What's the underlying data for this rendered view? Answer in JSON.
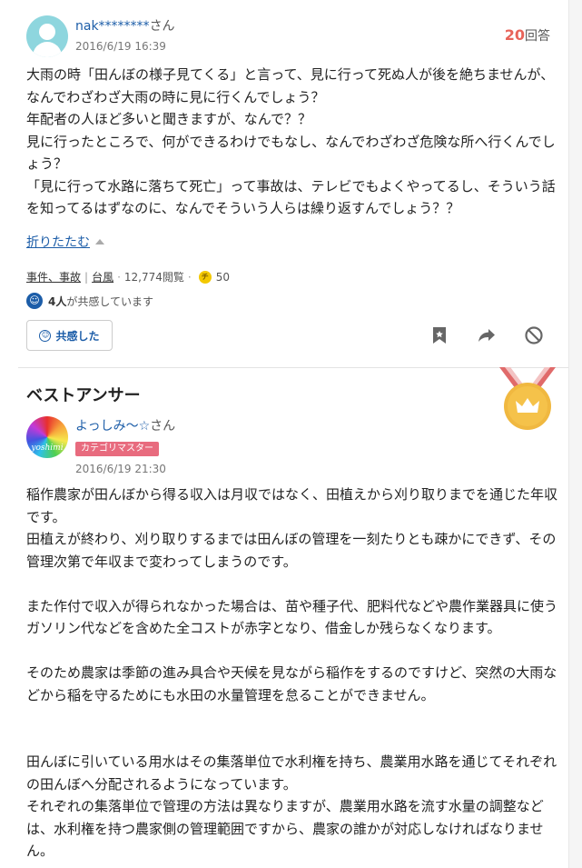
{
  "question": {
    "user_name": "nak********",
    "user_suffix": "さん",
    "date": "2016/6/19 16:39",
    "answer_count": "20",
    "answer_count_label": "回答",
    "lines": [
      "大雨の時「田んぼの様子見てくる」と言って、見に行って死ぬ人が後を絶ちませんが、なんでわざわざ大雨の時に見に行くんでしょう？",
      "年配者の人ほど多いと聞きますが、なんで？？",
      "見に行ったところで、何ができるわけでもなし、なんでわざわざ危険な所へ行くんでしょう？",
      "「見に行って水路に落ちて死亡」って事故は、テレビでもよくやってるし、そういう話を知ってるはずなのに、なんでそういう人らは繰り返すんでしょう？？"
    ],
    "collapse_label": "折りたたむ",
    "category1": "事件、事故",
    "category2": "台風",
    "views": "12,774閲覧",
    "coin_value": "50",
    "coin_symbol": "チ",
    "empathy_count": "4人",
    "empathy_text": "が共感しています",
    "empathy_icon": "☺",
    "empathy_button": "共感した"
  },
  "best_answer": {
    "title": "ベストアンサー",
    "avatar_text": "yoshimi",
    "user_name": "よっしみ〜☆",
    "user_suffix": "さん",
    "badge": "カテゴリマスター",
    "date": "2016/6/19 21:30",
    "paragraphs": [
      [
        "稲作農家が田んぼから得る収入は月収ではなく、田植えから刈り取りまでを通じた年収です。",
        "田植えが終わり、刈り取りするまでは田んぼの管理を一刻たりとも疎かにできず、その管理次第で年収まで変わってしまうのです。"
      ],
      [
        "また作付で収入が得られなかった場合は、苗や種子代、肥料代などや農作業器具に使うガソリン代などを含めた全コストが赤字となり、借金しか残らなくなります。"
      ],
      [
        "そのため農家は季節の進み具合や天候を見ながら稲作をするのですけど、突然の大雨などから稲を守るためにも水田の水量管理を怠ることができません。"
      ],
      [
        ""
      ],
      [
        "田んぼに引いている用水はその集落単位で水利権を持ち、農業用水路を通じてそれぞれの田んぼへ分配されるようになっています。",
        "それぞれの集落単位で管理の方法は異なりますが、農業用水路を流す水量の調整などは、水利権を持つ農家側の管理範囲ですから、農家の誰かが対応しなければなりません。"
      ]
    ]
  },
  "colors": {
    "link": "#1c5da8",
    "accent": "#e8645a",
    "badge": "#e86b7e",
    "medal_gold": "#f0b840",
    "medal_ribbon": "#e06a6a"
  }
}
